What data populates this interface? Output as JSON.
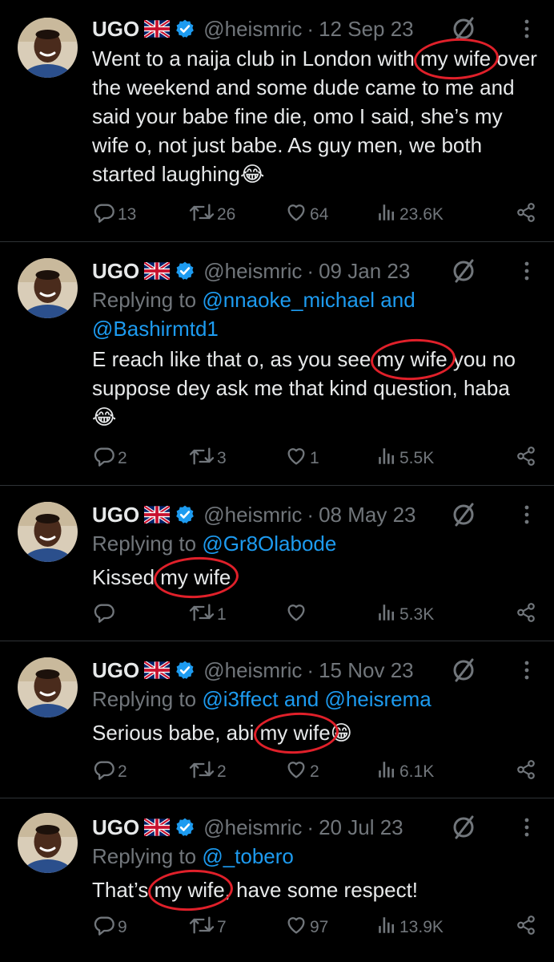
{
  "colors": {
    "background": "#000000",
    "text": "#e7e9ea",
    "muted": "#71767b",
    "link": "#1d9bf0",
    "verified": "#1d9bf0",
    "annotation_circle": "#e0202a"
  },
  "tweets": [
    {
      "name": "UGO",
      "flag": "uk-flag-icon",
      "handle": "@heismric",
      "dot": "·",
      "date": "12 Sep 23",
      "reply_prefix": "",
      "reply_mentions": "",
      "text_before": "Went to a naija club in London with ",
      "highlight": "my wife",
      "text_after": " over the weekend and some dude came to me and said your babe fine die, omo I said, she’s my wife o, not just babe. As guy men, we both started laughing",
      "emoji": "😂",
      "replies": "13",
      "retweets": "26",
      "likes": "64",
      "views": "23.6K"
    },
    {
      "name": "UGO",
      "flag": "uk-flag-icon",
      "handle": "@heismric",
      "dot": "·",
      "date": "09 Jan 23",
      "reply_prefix": "Replying to ",
      "reply_mentions": "@nnaoke_michael and @Bashirmtd1",
      "text_before": "E reach like that o, as you see ",
      "highlight": "my wife",
      "text_after": " you no suppose dey ask me that kind question, haba",
      "emoji": "😂",
      "replies": "2",
      "retweets": "3",
      "likes": "1",
      "views": "5.5K"
    },
    {
      "name": "UGO",
      "flag": "uk-flag-icon",
      "handle": "@heismric",
      "dot": "·",
      "date": "08 May 23",
      "reply_prefix": "Replying to ",
      "reply_mentions": "@Gr8Olabode",
      "text_before": "Kissed ",
      "highlight": "my wife",
      "text_after": "",
      "emoji": "",
      "replies": "",
      "retweets": "1",
      "likes": "",
      "views": "5.3K"
    },
    {
      "name": "UGO",
      "flag": "uk-flag-icon",
      "handle": "@heismric",
      "dot": "·",
      "date": "15 Nov 23",
      "reply_prefix": "Replying to ",
      "reply_mentions": "@i3ffect and @heisrema",
      "text_before": "Serious babe, abi ",
      "highlight": "my wife",
      "text_after": "",
      "emoji": "😁",
      "replies": "2",
      "retweets": "2",
      "likes": "2",
      "views": "6.1K"
    },
    {
      "name": "UGO",
      "flag": "uk-flag-icon",
      "handle": "@heismric",
      "dot": "·",
      "date": "20 Jul 23",
      "reply_prefix": "Replying to ",
      "reply_mentions": "@_tobero",
      "text_before": "That’s ",
      "highlight": "my wife",
      "text_after": ", have some respect!",
      "emoji": "",
      "replies": "9",
      "retweets": "7",
      "likes": "97",
      "views": "13.9K"
    }
  ]
}
